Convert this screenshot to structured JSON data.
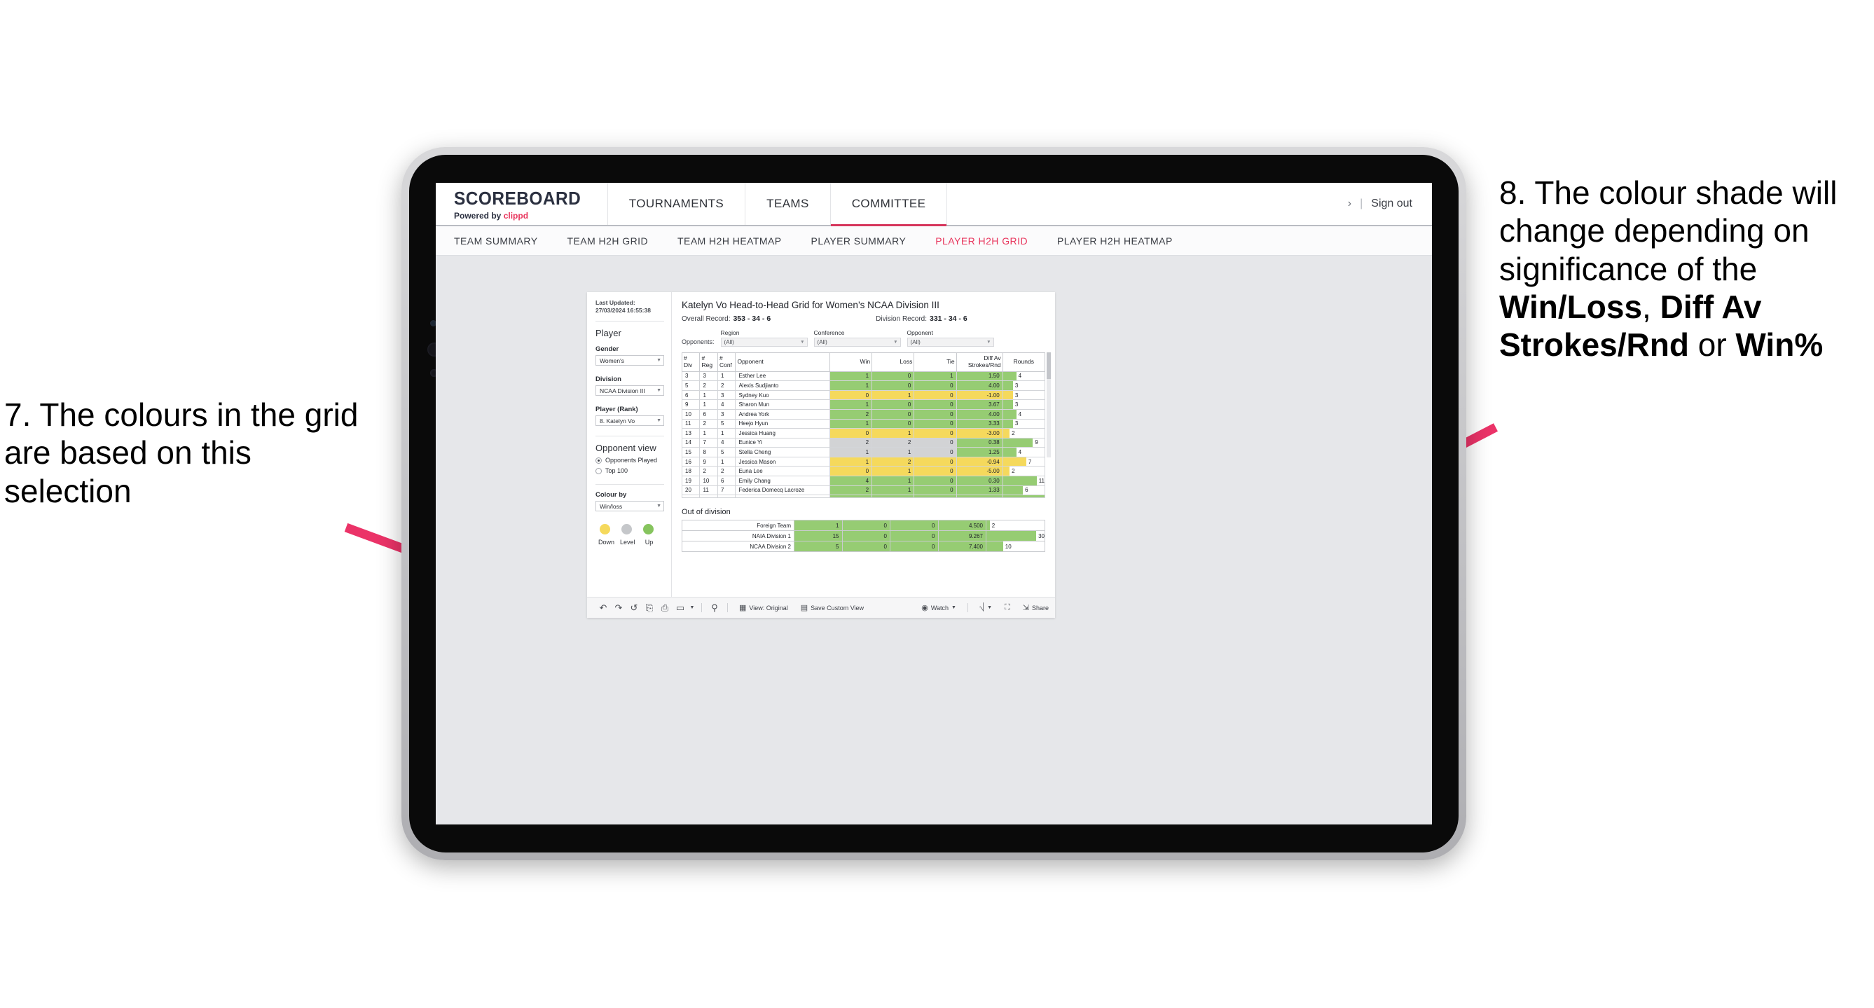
{
  "annotations": {
    "left": {
      "id": "7.",
      "text": "7. The colours in the grid are based on this selection"
    },
    "right": {
      "line1": "8. The colour shade will change depending on significance of the ",
      "bold1": "Win/Loss",
      "mid1": ", ",
      "bold2": "Diff Av Strokes/Rnd",
      "mid2": " or ",
      "bold3": "Win%"
    },
    "arrow_color": "#eb3368"
  },
  "header": {
    "brand_title": "SCOREBOARD",
    "brand_sub_prefix": "Powered by ",
    "brand_sub_accent": "clippd",
    "nav": [
      {
        "label": "TOURNAMENTS",
        "active": false
      },
      {
        "label": "TEAMS",
        "active": false
      },
      {
        "label": "COMMITTEE",
        "active": true
      }
    ],
    "chevron": "›",
    "divider": "|",
    "signout": "Sign out"
  },
  "subnav": [
    {
      "label": "TEAM SUMMARY",
      "active": false
    },
    {
      "label": "TEAM H2H GRID",
      "active": false
    },
    {
      "label": "TEAM H2H HEATMAP",
      "active": false
    },
    {
      "label": "PLAYER SUMMARY",
      "active": false
    },
    {
      "label": "PLAYER H2H GRID",
      "active": true
    },
    {
      "label": "PLAYER H2H HEATMAP",
      "active": false
    }
  ],
  "sidebar": {
    "last_updated": "Last Updated: 27/03/2024 16:55:38",
    "player_heading": "Player",
    "gender": {
      "label": "Gender",
      "value": "Women's"
    },
    "division": {
      "label": "Division",
      "value": "NCAA Division III"
    },
    "player_rank": {
      "label": "Player (Rank)",
      "value": "8. Katelyn Vo"
    },
    "opponent_view": {
      "heading": "Opponent view",
      "options": [
        {
          "label": "Opponents Played",
          "selected": true
        },
        {
          "label": "Top 100",
          "selected": false
        }
      ]
    },
    "colour_by": {
      "label": "Colour by",
      "value": "Win/loss"
    },
    "legend": [
      {
        "label": "Down",
        "color": "#f5d95c"
      },
      {
        "label": "Level",
        "color": "#c5c7ca"
      },
      {
        "label": "Up",
        "color": "#86c45e"
      }
    ]
  },
  "main": {
    "title": "Katelyn Vo Head-to-Head Grid for Women’s NCAA Division III",
    "overall_record": {
      "label": "Overall Record:",
      "value": "353 -  34 - 6"
    },
    "division_record": {
      "label": "Division Record:",
      "value": "331 -  34 - 6"
    },
    "opponents_label": "Opponents:",
    "filters": [
      {
        "label": "Region",
        "value": "(All)"
      },
      {
        "label": "Conference",
        "value": "(All)"
      },
      {
        "label": "Opponent",
        "value": "(All)"
      }
    ],
    "columns": [
      {
        "l1": "#",
        "l2": "Div"
      },
      {
        "l1": "#",
        "l2": "Reg"
      },
      {
        "l1": "#",
        "l2": "Conf"
      },
      {
        "l1": "Opponent",
        "l2": ""
      },
      {
        "l1": "Win",
        "l2": ""
      },
      {
        "l1": "Loss",
        "l2": ""
      },
      {
        "l1": "Tie",
        "l2": ""
      },
      {
        "l1": "Diff Av",
        "l2": "Strokes/Rnd"
      },
      {
        "l1": "Rounds",
        "l2": ""
      }
    ],
    "out_of_division_title": "Out of division"
  },
  "toolbar": {
    "view_label": "View: Original",
    "save_label": "Save Custom View",
    "watch_label": "Watch",
    "share_label": "Share"
  },
  "chart_data": {
    "type": "table",
    "title": "Katelyn Vo Head-to-Head Grid for Women’s NCAA Division III",
    "columns": [
      "# Div",
      "# Reg",
      "# Conf",
      "Opponent",
      "Win",
      "Loss",
      "Tie",
      "Diff Av Strokes/Rnd",
      "Rounds"
    ],
    "rows": [
      {
        "div": "3",
        "reg": "3",
        "conf": "1",
        "opponent": "Esther Lee",
        "win": "1",
        "loss": "0",
        "tie": "1",
        "diff": "1.50",
        "rounds": "4",
        "wl_state": "up",
        "diff_state": "up",
        "rounds_val": 4
      },
      {
        "div": "5",
        "reg": "2",
        "conf": "2",
        "opponent": "Alexis Sudjianto",
        "win": "1",
        "loss": "0",
        "tie": "0",
        "diff": "4.00",
        "rounds": "3",
        "wl_state": "up",
        "diff_state": "up",
        "rounds_val": 3
      },
      {
        "div": "6",
        "reg": "1",
        "conf": "3",
        "opponent": "Sydney Kuo",
        "win": "0",
        "loss": "1",
        "tie": "0",
        "diff": "-1.00",
        "rounds": "3",
        "wl_state": "down",
        "diff_state": "down",
        "rounds_val": 3
      },
      {
        "div": "9",
        "reg": "1",
        "conf": "4",
        "opponent": "Sharon Mun",
        "win": "1",
        "loss": "0",
        "tie": "0",
        "diff": "3.67",
        "rounds": "3",
        "wl_state": "up",
        "diff_state": "up",
        "rounds_val": 3
      },
      {
        "div": "10",
        "reg": "6",
        "conf": "3",
        "opponent": "Andrea York",
        "win": "2",
        "loss": "0",
        "tie": "0",
        "diff": "4.00",
        "rounds": "4",
        "wl_state": "up",
        "diff_state": "up",
        "rounds_val": 4
      },
      {
        "div": "11",
        "reg": "2",
        "conf": "5",
        "opponent": "Heejo Hyun",
        "win": "1",
        "loss": "0",
        "tie": "0",
        "diff": "3.33",
        "rounds": "3",
        "wl_state": "up",
        "diff_state": "up",
        "rounds_val": 3
      },
      {
        "div": "13",
        "reg": "1",
        "conf": "1",
        "opponent": "Jessica Huang",
        "win": "0",
        "loss": "1",
        "tie": "0",
        "diff": "-3.00",
        "rounds": "2",
        "wl_state": "down",
        "diff_state": "down",
        "rounds_val": 2
      },
      {
        "div": "14",
        "reg": "7",
        "conf": "4",
        "opponent": "Eunice Yi",
        "win": "2",
        "loss": "2",
        "tie": "0",
        "diff": "0.38",
        "rounds": "9",
        "wl_state": "level",
        "diff_state": "up",
        "rounds_val": 9
      },
      {
        "div": "15",
        "reg": "8",
        "conf": "5",
        "opponent": "Stella Cheng",
        "win": "1",
        "loss": "1",
        "tie": "0",
        "diff": "1.25",
        "rounds": "4",
        "wl_state": "level",
        "diff_state": "up",
        "rounds_val": 4
      },
      {
        "div": "16",
        "reg": "9",
        "conf": "1",
        "opponent": "Jessica Mason",
        "win": "1",
        "loss": "2",
        "tie": "0",
        "diff": "-0.94",
        "rounds": "7",
        "wl_state": "down",
        "diff_state": "down",
        "rounds_val": 7
      },
      {
        "div": "18",
        "reg": "2",
        "conf": "2",
        "opponent": "Euna Lee",
        "win": "0",
        "loss": "1",
        "tie": "0",
        "diff": "-5.00",
        "rounds": "2",
        "wl_state": "down",
        "diff_state": "down",
        "rounds_val": 2
      },
      {
        "div": "19",
        "reg": "10",
        "conf": "6",
        "opponent": "Emily Chang",
        "win": "4",
        "loss": "1",
        "tie": "0",
        "diff": "0.30",
        "rounds": "11",
        "wl_state": "up",
        "diff_state": "up",
        "rounds_val": 11
      },
      {
        "div": "20",
        "reg": "11",
        "conf": "7",
        "opponent": "Federica Domecq Lacroze",
        "win": "2",
        "loss": "1",
        "tie": "0",
        "diff": "1.33",
        "rounds": "6",
        "wl_state": "up",
        "diff_state": "up",
        "rounds_val": 6
      }
    ],
    "out_of_division": [
      {
        "name": "Foreign Team",
        "win": "1",
        "loss": "0",
        "tie": "0",
        "diff": "4.500",
        "rounds": "2",
        "wl_state": "up",
        "diff_state": "up",
        "rounds_val": 2
      },
      {
        "name": "NAIA Division 1",
        "win": "15",
        "loss": "0",
        "tie": "0",
        "diff": "9.267",
        "rounds": "30",
        "wl_state": "up",
        "diff_state": "up",
        "rounds_val": 30
      },
      {
        "name": "NCAA Division 2",
        "win": "5",
        "loss": "0",
        "tie": "0",
        "diff": "7.400",
        "rounds": "10",
        "wl_state": "up",
        "diff_state": "up",
        "rounds_val": 10
      }
    ],
    "colors": {
      "up": "#96cc73",
      "down": "#f5d95c",
      "level": "#d2d3d5"
    }
  }
}
